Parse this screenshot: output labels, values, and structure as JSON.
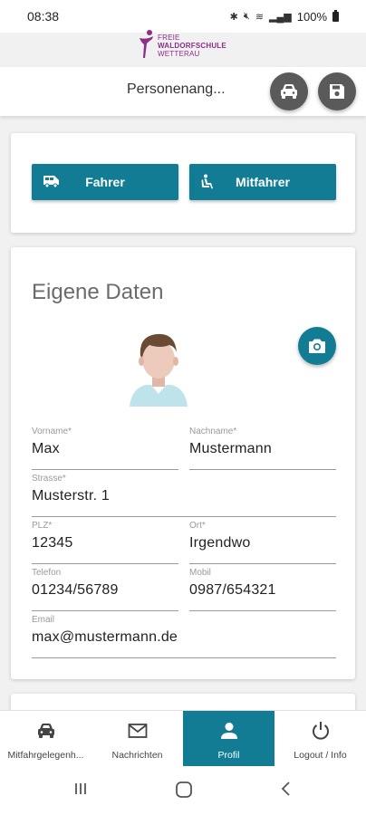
{
  "status_bar": {
    "time": "08:38",
    "battery": "100%",
    "icons": [
      "bluetooth-icon",
      "mute-icon",
      "wifi-icon",
      "signal-icon",
      "battery-icon"
    ]
  },
  "logo": {
    "line1": "FREIE",
    "line2": "WALDORFSCHULE",
    "line3": "WETTERAU"
  },
  "header": {
    "title": "Personenang...",
    "buttons": [
      "car-icon",
      "save-icon"
    ]
  },
  "roles": {
    "driver_label": "Fahrer",
    "passenger_label": "Mitfahrer"
  },
  "profile": {
    "title": "Eigene Daten",
    "fields": {
      "vorname": {
        "label": "Vorname*",
        "value": "Max"
      },
      "nachname": {
        "label": "Nachname*",
        "value": "Mustermann"
      },
      "strasse": {
        "label": "Strasse*",
        "value": "Musterstr. 1"
      },
      "plz": {
        "label": "PLZ*",
        "value": "12345"
      },
      "ort": {
        "label": "Ort*",
        "value": "Irgendwo"
      },
      "telefon": {
        "label": "Telefon",
        "value": "01234/56789"
      },
      "mobil": {
        "label": "Mobil",
        "value": "0987/654321"
      },
      "email": {
        "label": "Email",
        "value": "max@mustermann.de"
      }
    }
  },
  "bottom_nav": {
    "items": [
      {
        "label": "Mitfahrgelegenh...",
        "icon": "car-icon",
        "active": false
      },
      {
        "label": "Nachrichten",
        "icon": "mail-icon",
        "active": false
      },
      {
        "label": "Profil",
        "icon": "person-icon",
        "active": true
      },
      {
        "label": "Logout / Info",
        "icon": "power-icon",
        "active": false
      }
    ]
  },
  "colors": {
    "accent": "#117c94",
    "header_buttons": "#5a5a5a",
    "logo": "#8e2d8c"
  }
}
